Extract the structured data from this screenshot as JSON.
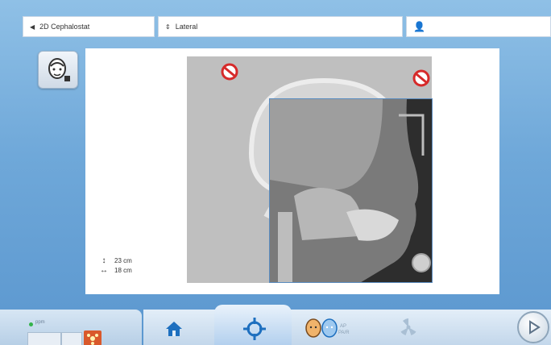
{
  "topbar": {
    "program": "2D Cephalostat",
    "projection": "Lateral",
    "program_icon": "left-triangle-icon",
    "projection_icon": "up-down-arrow-icon",
    "patient_icon": "standing-person-icon"
  },
  "dimensions": {
    "height": "23 cm",
    "width": "18 cm"
  },
  "bottom": {
    "status_label": "ppm",
    "series_label_1": "AP",
    "series_label_2": "PA/R"
  },
  "colors": {
    "accent_blue": "#5b97cf",
    "forbidden_red": "#d62a2a",
    "status_green": "#33b34a",
    "warning_orange": "#d9582b"
  }
}
